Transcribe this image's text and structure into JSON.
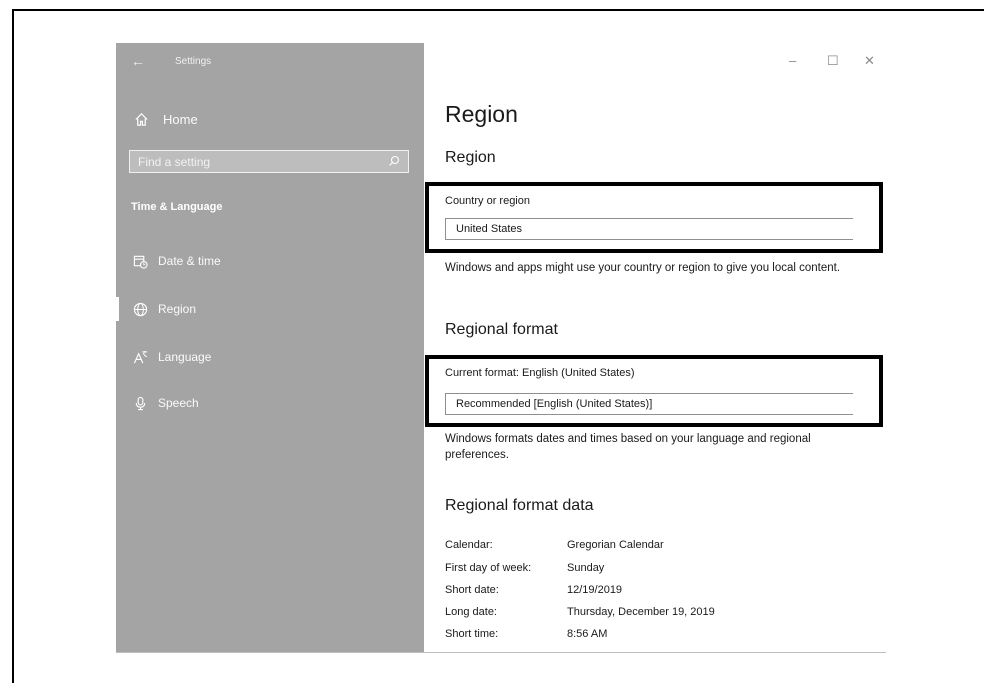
{
  "window": {
    "app_title": "Settings",
    "back_glyph": "←",
    "minimize_glyph": "–",
    "maximize_glyph": "☐",
    "close_glyph": "✕"
  },
  "sidebar": {
    "home_label": "Home",
    "search_placeholder": "Find a setting",
    "section_header": "Time & Language",
    "items": [
      {
        "label": "Date & time",
        "icon": "calendar-clock-icon",
        "active": false
      },
      {
        "label": "Region",
        "icon": "globe-icon",
        "active": true
      },
      {
        "label": "Language",
        "icon": "language-icon",
        "active": false
      },
      {
        "label": "Speech",
        "icon": "microphone-icon",
        "active": false
      }
    ]
  },
  "content": {
    "page_title": "Region",
    "region_heading": "Region",
    "country_label": "Country or region",
    "country_value": "United States",
    "country_desc": "Windows and apps might use your country or region to give you local content.",
    "format_heading": "Regional format",
    "current_format_label": "Current format: English (United States)",
    "format_value": "Recommended [English (United States)]",
    "format_desc": "Windows formats dates and times based on your language and regional preferences.",
    "format_data_heading": "Regional format data",
    "format_data": [
      {
        "key": "Calendar:",
        "value": "Gregorian Calendar"
      },
      {
        "key": "First day of week:",
        "value": "Sunday"
      },
      {
        "key": "Short date:",
        "value": "12/19/2019"
      },
      {
        "key": "Long date:",
        "value": "Thursday, December 19, 2019"
      },
      {
        "key": "Short time:",
        "value": "8:56 AM"
      }
    ]
  },
  "colors": {
    "sidebar_bg": "#a4a4a4",
    "highlight_border": "#000000"
  }
}
